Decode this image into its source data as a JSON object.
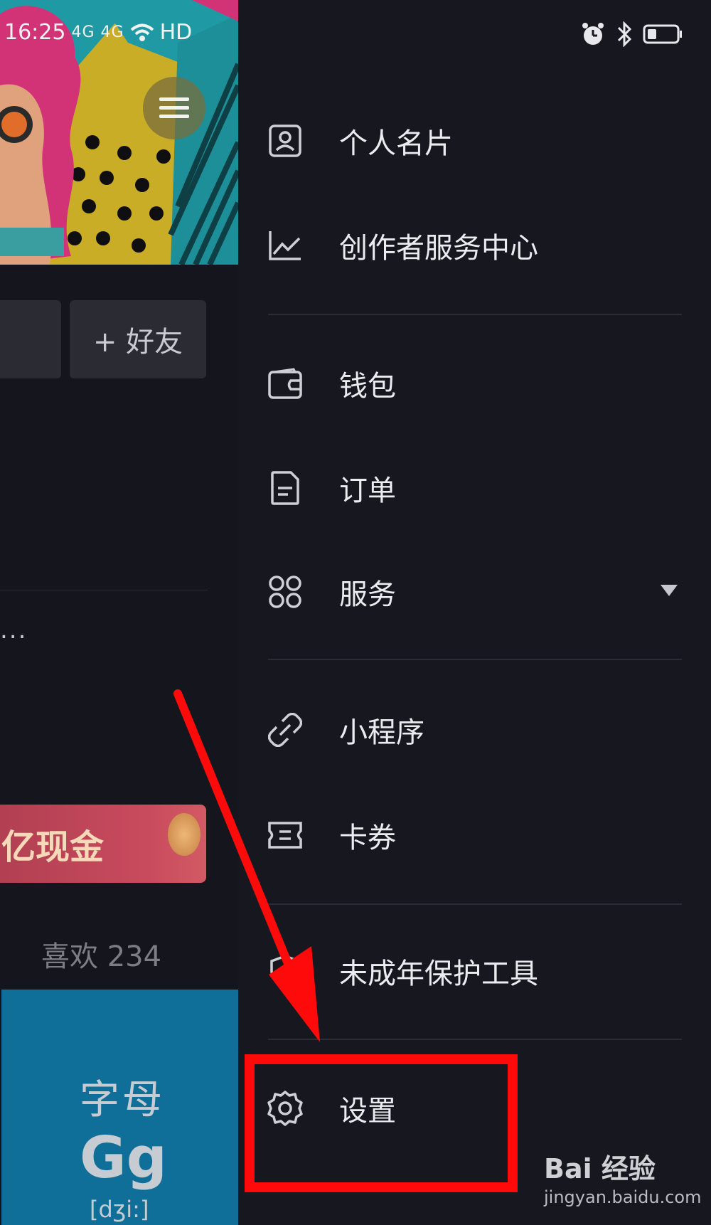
{
  "status_bar": {
    "time": "16:25",
    "network_1": "4G",
    "network_2": "4G",
    "hd": "HD"
  },
  "profile": {
    "add_friend_label": "+ 好友",
    "more_label": "...",
    "promo_text": "亿现金",
    "likes_label": "喜欢 234",
    "thumb_line1": "字母",
    "thumb_line2": "Gg",
    "thumb_line3": "[dʒi:]"
  },
  "drawer": {
    "items": [
      {
        "label": "个人名片",
        "icon": "id-card-icon"
      },
      {
        "label": "创作者服务中心",
        "icon": "chart-icon"
      },
      {
        "label": "钱包",
        "icon": "wallet-icon"
      },
      {
        "label": "订单",
        "icon": "document-icon"
      },
      {
        "label": "服务",
        "icon": "grid-icon"
      },
      {
        "label": "小程序",
        "icon": "link-icon"
      },
      {
        "label": "卡券",
        "icon": "ticket-icon"
      },
      {
        "label": "未成年保护工具",
        "icon": "shield-icon"
      },
      {
        "label": "设置",
        "icon": "gear-icon"
      }
    ]
  },
  "annotation": {
    "highlight_color": "#ff0a0a"
  },
  "watermark": {
    "brand": "Bai 经验",
    "url": "jingyan.baidu.com"
  }
}
